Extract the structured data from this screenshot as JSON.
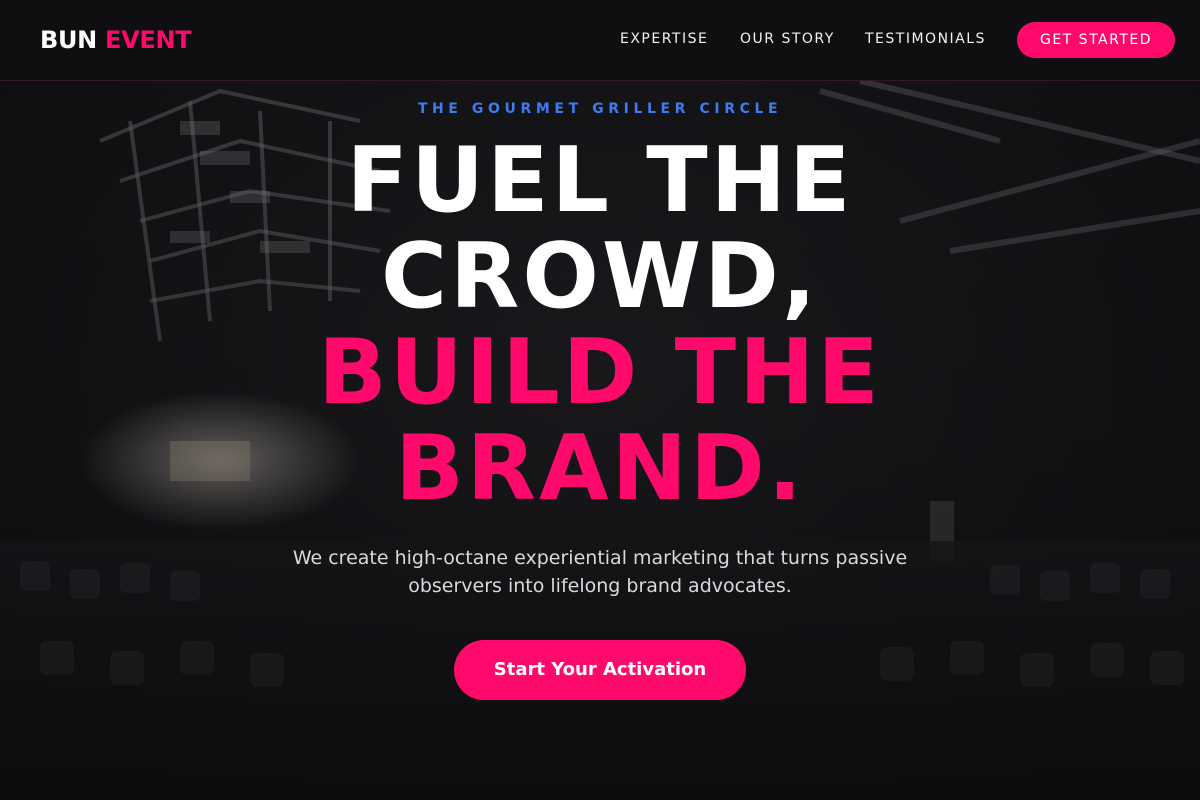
{
  "header": {
    "logo_part1": "BUN",
    "logo_part2": "EVENT",
    "nav": [
      {
        "label": "EXPERTISE"
      },
      {
        "label": "OUR STORY"
      },
      {
        "label": "TESTIMONIALS"
      }
    ],
    "cta_label": "GET STARTED"
  },
  "hero": {
    "eyebrow": "THE GOURMET GRILLER CIRCLE",
    "headline_line1": "FUEL THE",
    "headline_line2": "CROWD,",
    "headline_line3": "BUILD THE",
    "headline_line4": "BRAND.",
    "subtext": "We create high-octane experiential marketing that turns passive observers into lifelong brand advocates.",
    "cta_label": "Start Your Activation",
    "background_image": "dark-event-hall"
  },
  "colors": {
    "accent": "#ff0a6c",
    "eyebrow": "#3d7bf0",
    "background": "#0d0d0f",
    "text": "#ffffff"
  }
}
